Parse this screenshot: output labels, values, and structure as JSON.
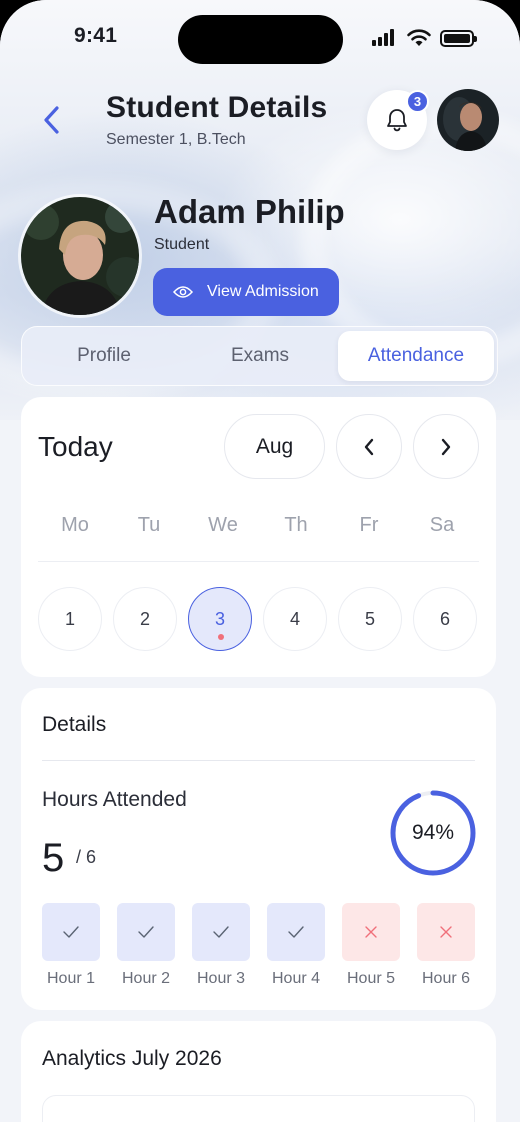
{
  "status_bar": {
    "time": "9:41"
  },
  "header": {
    "title": "Student Details",
    "subtitle": "Semester 1, B.Tech",
    "notification_count": "3"
  },
  "profile": {
    "name": "Adam Philip",
    "role": "Student",
    "view_admission_label": "View Admission"
  },
  "tabs": [
    {
      "label": "Profile"
    },
    {
      "label": "Exams"
    },
    {
      "label": "Attendance",
      "active": true
    }
  ],
  "calendar": {
    "today_label": "Today",
    "month": "Aug",
    "weekdays": [
      "Mo",
      "Tu",
      "We",
      "Th",
      "Fr",
      "Sa"
    ],
    "days": [
      "1",
      "2",
      "3",
      "4",
      "5",
      "6"
    ],
    "selected_day": "3"
  },
  "details": {
    "title": "Details",
    "hours_label": "Hours Attended",
    "hours_attended": "5",
    "hours_total": "/ 6",
    "percent": "94%",
    "percent_value": 0.94,
    "hours": [
      {
        "label": "Hour 1",
        "status": "present"
      },
      {
        "label": "Hour 2",
        "status": "present"
      },
      {
        "label": "Hour 3",
        "status": "present"
      },
      {
        "label": "Hour 4",
        "status": "present"
      },
      {
        "label": "Hour 5",
        "status": "absent"
      },
      {
        "label": "Hour 6",
        "status": "absent"
      }
    ]
  },
  "analytics": {
    "title": "Analytics July 2026"
  },
  "colors": {
    "accent": "#4a61e0",
    "present_bg": "#e4e8fb",
    "absent_bg": "#fde7e7",
    "absent_mark": "#f0707a"
  }
}
